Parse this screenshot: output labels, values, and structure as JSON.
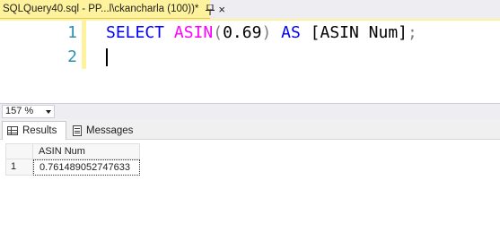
{
  "document_tab": {
    "title": "SQLQuery40.sql - PP...l\\ckancharla (100))*",
    "pin_icon": "pin-icon",
    "close_icon": "close-icon",
    "close_glyph": "×"
  },
  "editor": {
    "lines": [
      {
        "number": "1",
        "tokens": [
          {
            "text": "SELECT",
            "kind": "keyword"
          },
          {
            "text": " ",
            "kind": "plain"
          },
          {
            "text": "ASIN",
            "kind": "function"
          },
          {
            "text": "(",
            "kind": "operator"
          },
          {
            "text": "0.69",
            "kind": "plain"
          },
          {
            "text": ")",
            "kind": "operator"
          },
          {
            "text": " ",
            "kind": "plain"
          },
          {
            "text": "AS",
            "kind": "keyword"
          },
          {
            "text": " [ASIN Num]",
            "kind": "plain"
          },
          {
            "text": ";",
            "kind": "operator"
          }
        ]
      },
      {
        "number": "2",
        "tokens": []
      }
    ],
    "colors": {
      "keyword": "#0000ff",
      "function": "#ff00ff",
      "operator": "#808080",
      "line_number": "#2b91af",
      "change_bar": "#fff29d"
    }
  },
  "zoom": {
    "value": "157 %"
  },
  "results_tabs": [
    {
      "label": "Results",
      "icon": "grid-icon",
      "selected": true
    },
    {
      "label": "Messages",
      "icon": "messages-icon",
      "selected": false
    }
  ],
  "grid": {
    "columns": [
      "ASIN Num"
    ],
    "rows": [
      {
        "row_number": "1",
        "cells": [
          "0.761489052747633"
        ]
      }
    ]
  }
}
